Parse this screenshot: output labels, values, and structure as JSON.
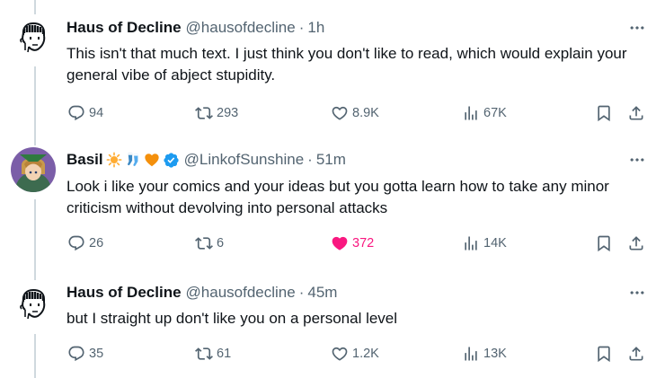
{
  "tweets": [
    {
      "name": "Haus of Decline",
      "handle": "@hausofdecline",
      "time": "1h",
      "text": "This isn't that much text. I just think you don't like to read, which would explain your general vibe of abject stupidity.",
      "replies": "94",
      "reposts": "293",
      "likes": "8.9K",
      "views": "67K",
      "liked": false
    },
    {
      "name": "Basil",
      "name_emojis": [
        "sun-emoji",
        "socks-emoji",
        "orange-heart-emoji"
      ],
      "verified": true,
      "handle": "@LinkofSunshine",
      "time": "51m",
      "text": "Look i like your comics and your ideas but you gotta learn how to take any minor criticism without devolving into personal attacks",
      "replies": "26",
      "reposts": "6",
      "likes": "372",
      "views": "14K",
      "liked": true
    },
    {
      "name": "Haus of Decline",
      "handle": "@hausofdecline",
      "time": "45m",
      "text": "but I straight up don't like you on a personal level",
      "replies": "35",
      "reposts": "61",
      "likes": "1.2K",
      "views": "13K",
      "liked": false
    }
  ],
  "separator": "·",
  "colors": {
    "text": "#0f1419",
    "secondary": "#536471",
    "like_active": "#f91880",
    "verified": "#1d9bf0",
    "thread_line": "#cfd9de"
  },
  "icons": [
    "reply-icon",
    "repost-icon",
    "like-icon",
    "views-icon",
    "bookmark-icon",
    "share-icon",
    "more-icon",
    "verified-badge-icon"
  ]
}
